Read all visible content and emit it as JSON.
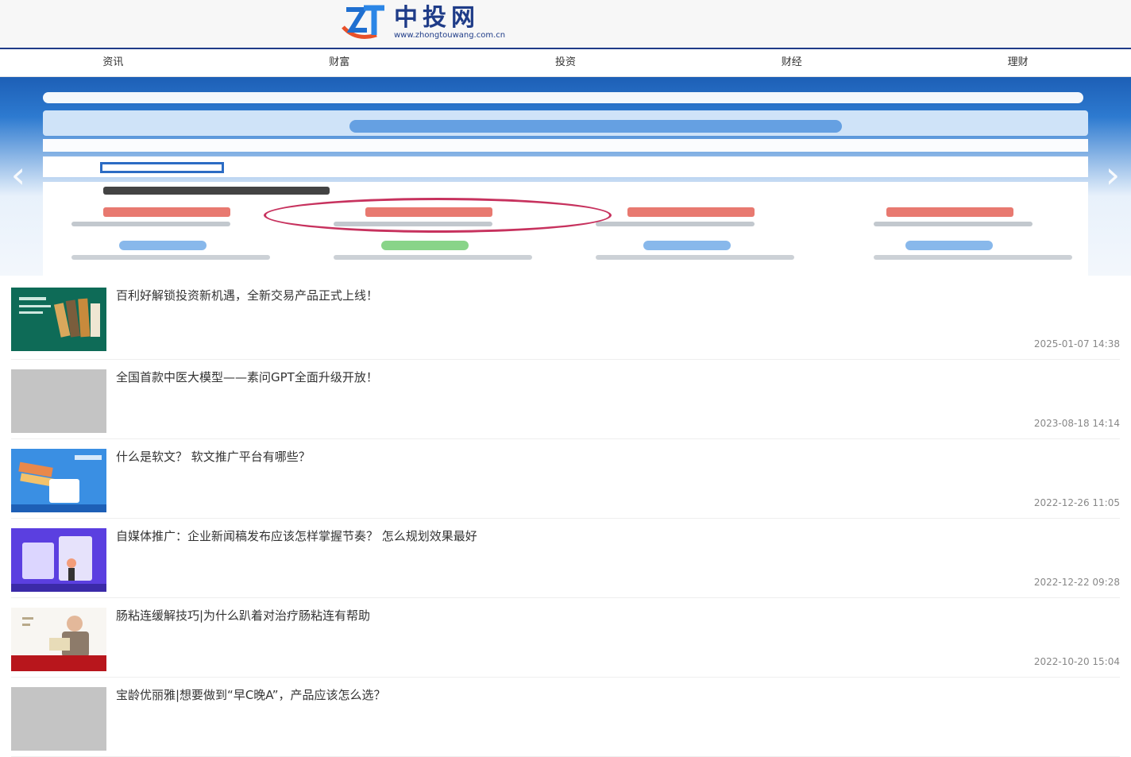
{
  "site": {
    "logo_text": "中投网",
    "logo_url_text": "www.zhongtouwang.com.cn"
  },
  "nav": [
    "资讯",
    "财富",
    "投资",
    "财经",
    "理财"
  ],
  "banner": {
    "prev_label": "‹",
    "next_label": "›"
  },
  "articles": [
    {
      "title": "百利好解锁投资新机遇，全新交易产品正式上线！",
      "date": "2025-01-07 14:38"
    },
    {
      "title": "全国首款中医大模型——素问GPT全面升级开放！",
      "date": "2023-08-18 14:14"
    },
    {
      "title": "什么是软文？ 软文推广平台有哪些？",
      "date": "2022-12-26 11:05"
    },
    {
      "title": "自媒体推广：企业新闻稿发布应该怎样掌握节奏？ 怎么规划效果最好",
      "date": "2022-12-22 09:28"
    },
    {
      "title": "肠粘连缓解技巧|为什么趴着对治疗肠粘连有帮助",
      "date": "2022-10-20 15:04"
    },
    {
      "title": "宝龄优丽雅|想要做到“早C晚A”，产品应该怎么选？",
      "date": ""
    }
  ]
}
